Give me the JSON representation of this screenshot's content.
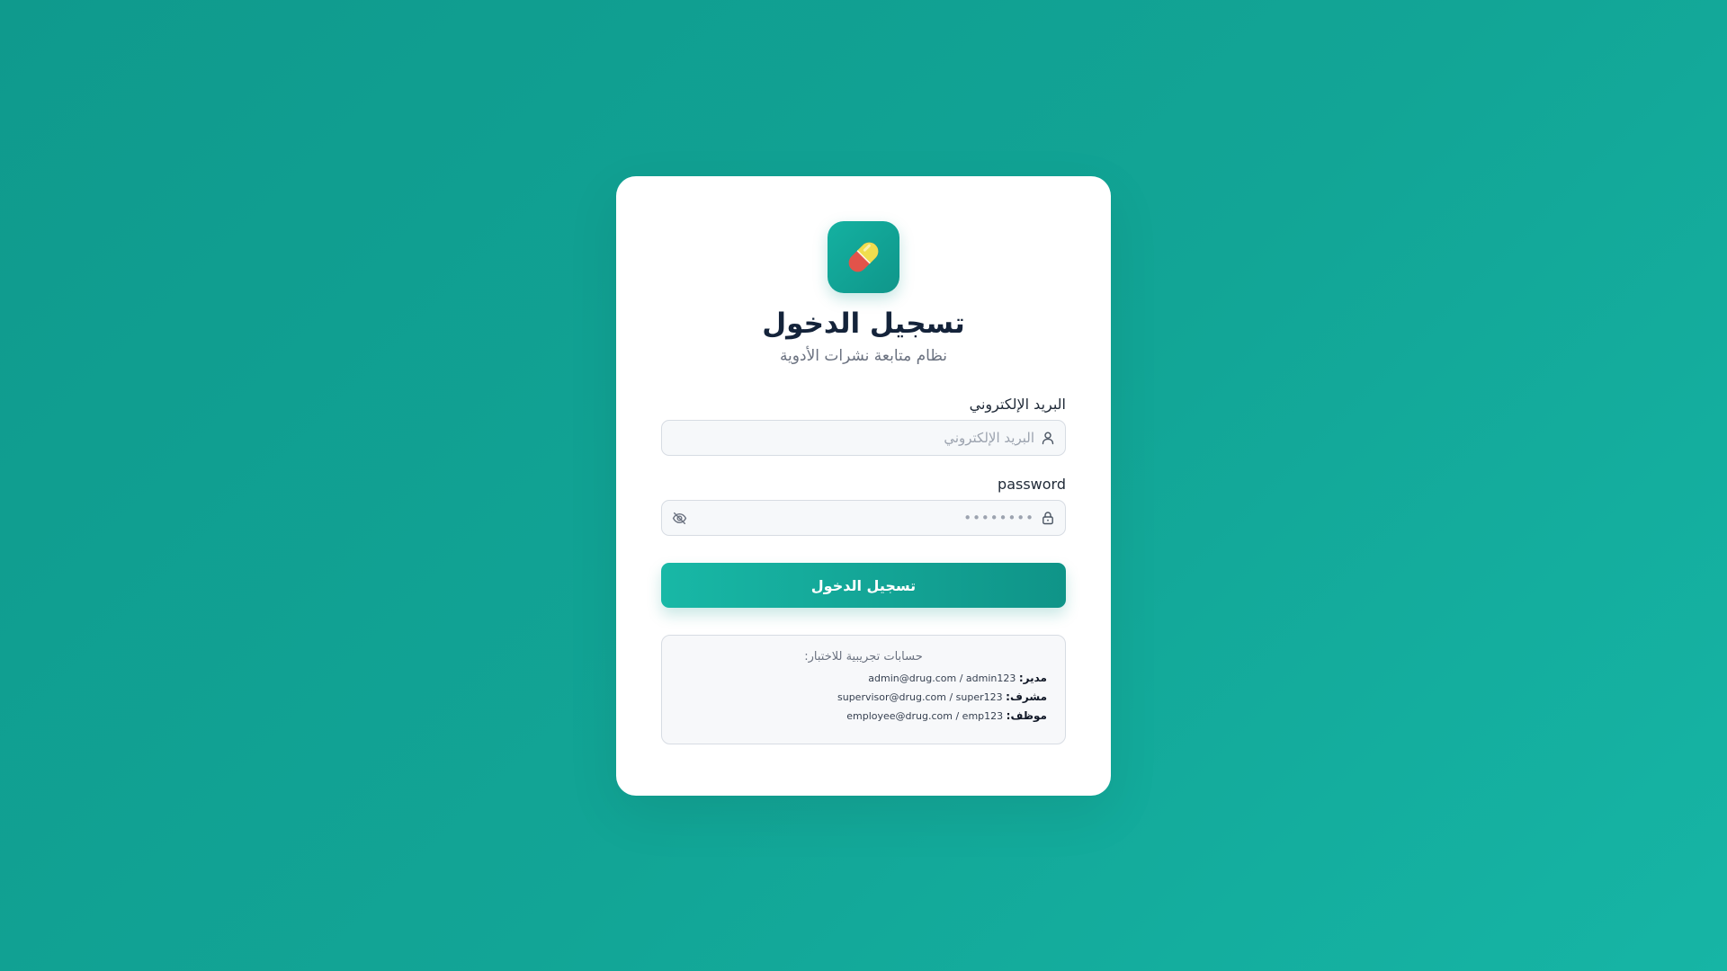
{
  "login": {
    "title": "تسجيل الدخول",
    "subtitle": "نظام متابعة نشرات الأدوية",
    "logo_icon": "pill-capsule-icon",
    "email_label": "البريد الإلكتروني",
    "email_placeholder": "البريد الإلكتروني",
    "email_value": "",
    "password_label": "password",
    "password_placeholder": "••••••••",
    "password_value": "",
    "submit_label": "تسجيل الدخول"
  },
  "demo_accounts": {
    "title": "حسابات تجريبية للاختبار:",
    "accounts": [
      {
        "role": "مدير:",
        "credentials": "admin@drug.com / admin123"
      },
      {
        "role": "مشرف:",
        "credentials": "supervisor@drug.com / super123"
      },
      {
        "role": "موظف:",
        "credentials": "employee@drug.com / emp123"
      }
    ]
  },
  "colors": {
    "background": "#12a596",
    "accent": "#14b1a1",
    "title": "#14233a",
    "card": "#ffffff"
  }
}
